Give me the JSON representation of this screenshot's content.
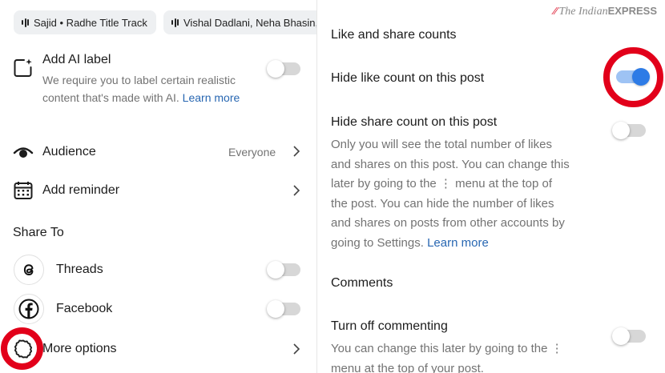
{
  "left": {
    "chips": [
      {
        "label": "Sajid • Radhe Title Track"
      },
      {
        "label": "Vishal Dadlani, Neha Bhasin,"
      }
    ],
    "ai_label": {
      "title": "Add AI label",
      "description": "We require you to label certain realistic content that's made with AI.",
      "link": "Learn more",
      "toggle_on": false
    },
    "audience": {
      "label": "Audience",
      "value": "Everyone"
    },
    "reminder": {
      "label": "Add reminder"
    },
    "share_to": {
      "heading": "Share To"
    },
    "threads": {
      "label": "Threads",
      "toggle_on": false
    },
    "facebook": {
      "label": "Facebook",
      "toggle_on": false
    },
    "more_options": {
      "label": "More options"
    }
  },
  "right": {
    "watermark": {
      "brand_prefix": "The Indian",
      "brand_suffix": "EXPRESS"
    },
    "like_share_heading": "Like and share counts",
    "hide_like": {
      "label": "Hide like count on this post",
      "toggle_on": true
    },
    "hide_share": {
      "label": "Hide share count on this post",
      "description_lines": [
        "Only you will see the total number of likes",
        "and shares on this post. You can change this",
        "later by going to the ⋮ menu at the top of",
        "the post. You can hide the number of likes",
        "and shares on posts from other accounts by",
        "going to Settings."
      ],
      "link": "Learn more",
      "toggle_on": false
    },
    "comments_heading": "Comments",
    "turn_off_commenting": {
      "label": "Turn off commenting",
      "description_lines": [
        "You can change this later by going to the ⋮",
        "menu at the top of your post."
      ],
      "toggle_on": false
    }
  },
  "colors": {
    "accent_blue": "#2d7be6",
    "link_blue": "#2867b2",
    "highlight_red": "#e2001a",
    "toggle_off": "#d7d7d7"
  }
}
